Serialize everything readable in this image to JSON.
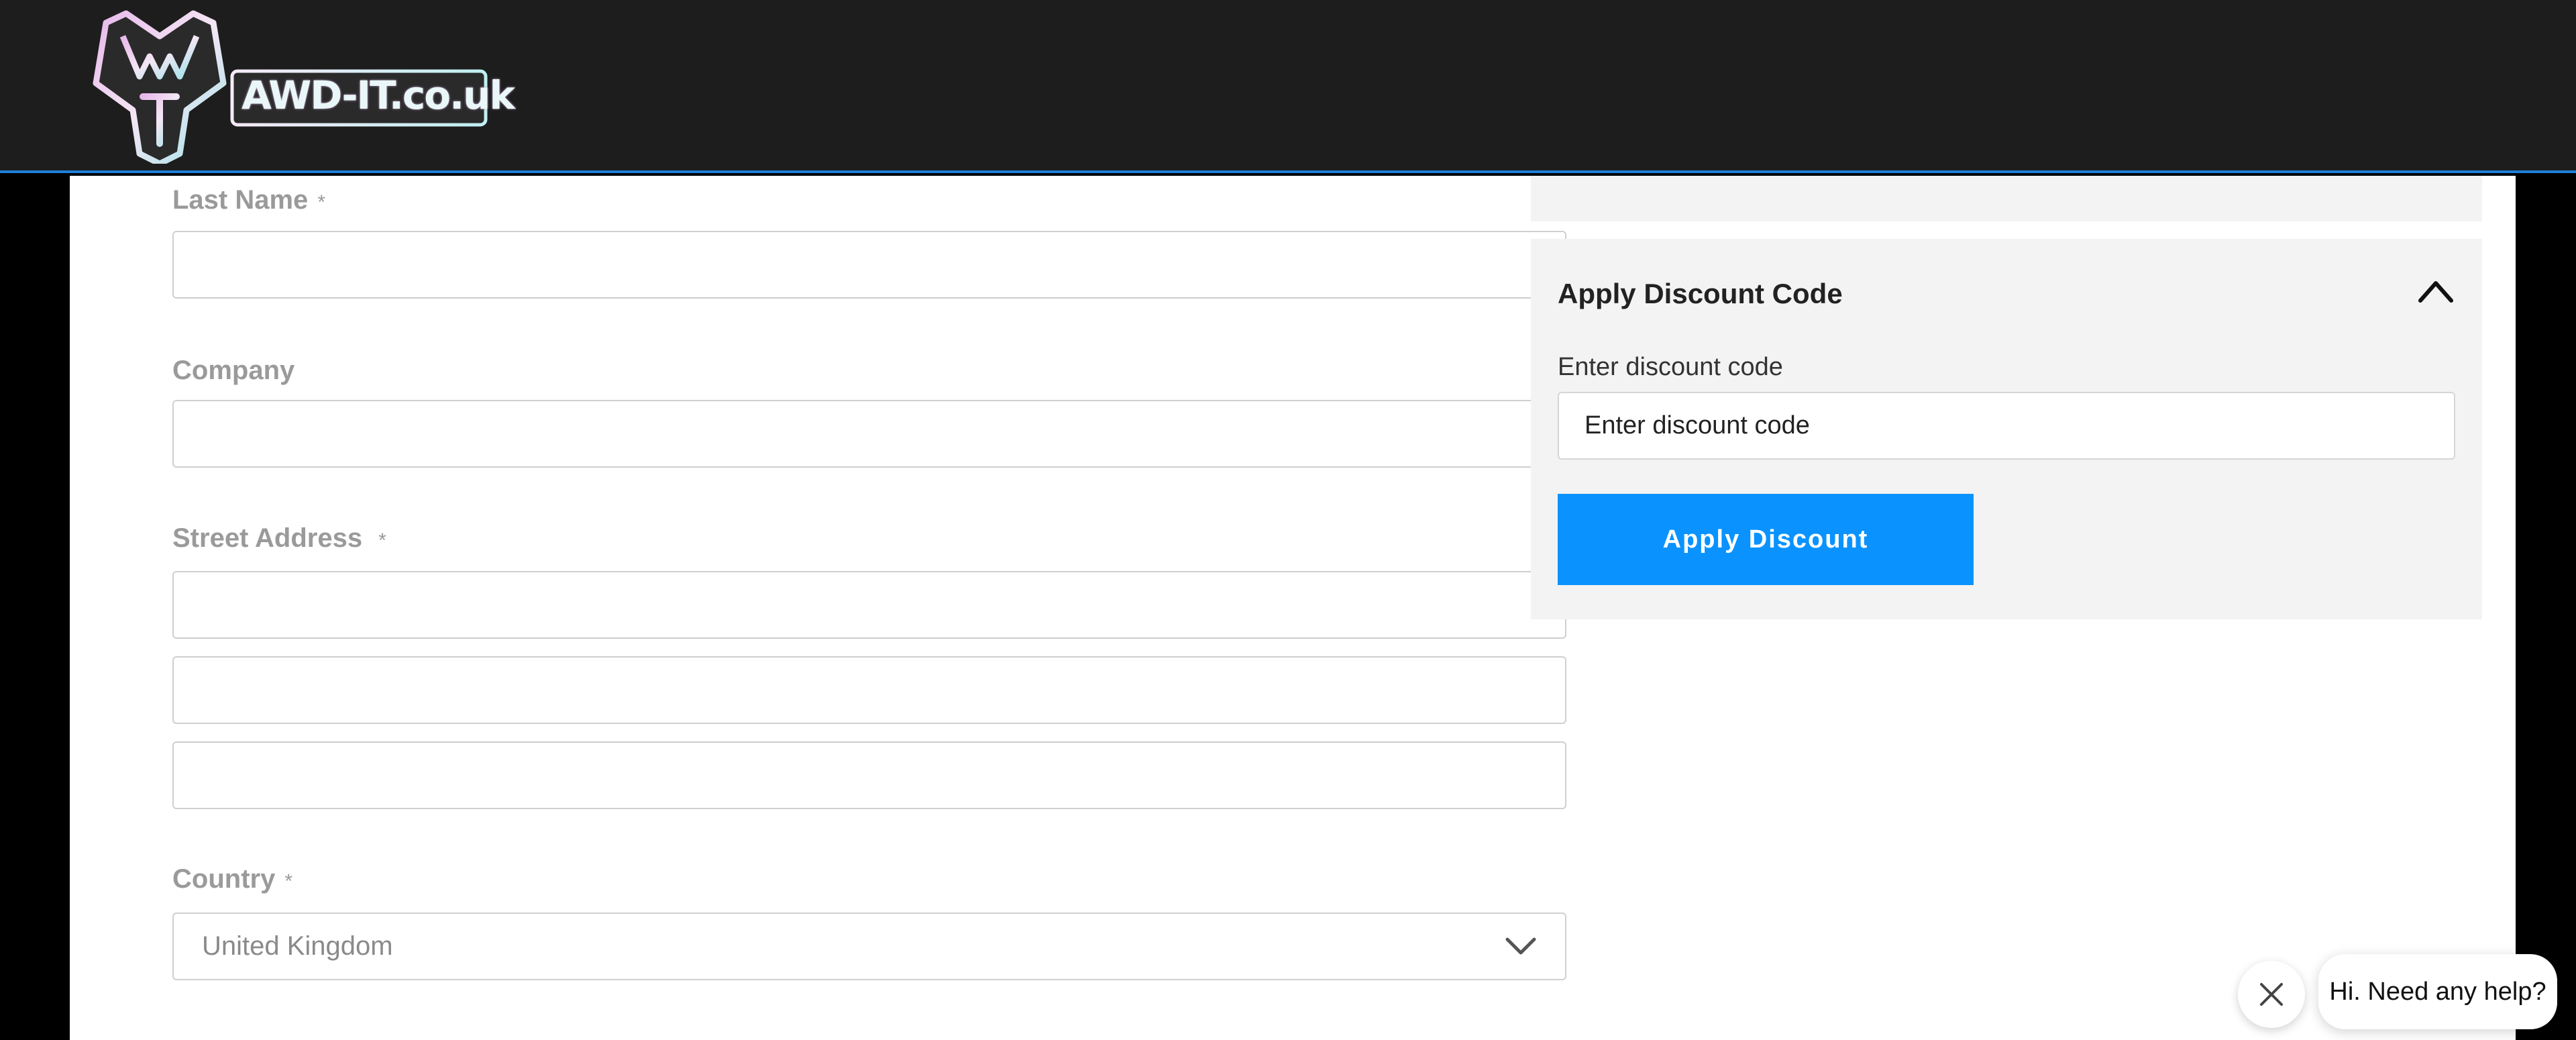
{
  "header": {
    "logo_text": "AWD-IT.co.uk",
    "accent_border_color": "#1e7fd8"
  },
  "form": {
    "last_name": {
      "label": "Last Name",
      "required": "*",
      "value": ""
    },
    "company": {
      "label": "Company",
      "value": ""
    },
    "street_address": {
      "label": "Street Address",
      "required": "*",
      "lines": [
        "",
        "",
        ""
      ]
    },
    "country": {
      "label": "Country",
      "required": "*",
      "value": "United Kingdom",
      "icon": "chevron-down-icon"
    }
  },
  "discount": {
    "title": "Apply Discount Code",
    "toggle_icon": "chevron-up-icon",
    "field_label": "Enter discount code",
    "placeholder": "Enter discount code",
    "button_label": "Apply Discount",
    "button_color": "#0a93ff"
  },
  "chat": {
    "close_icon": "close-icon",
    "message": "Hi. Need any help?"
  }
}
